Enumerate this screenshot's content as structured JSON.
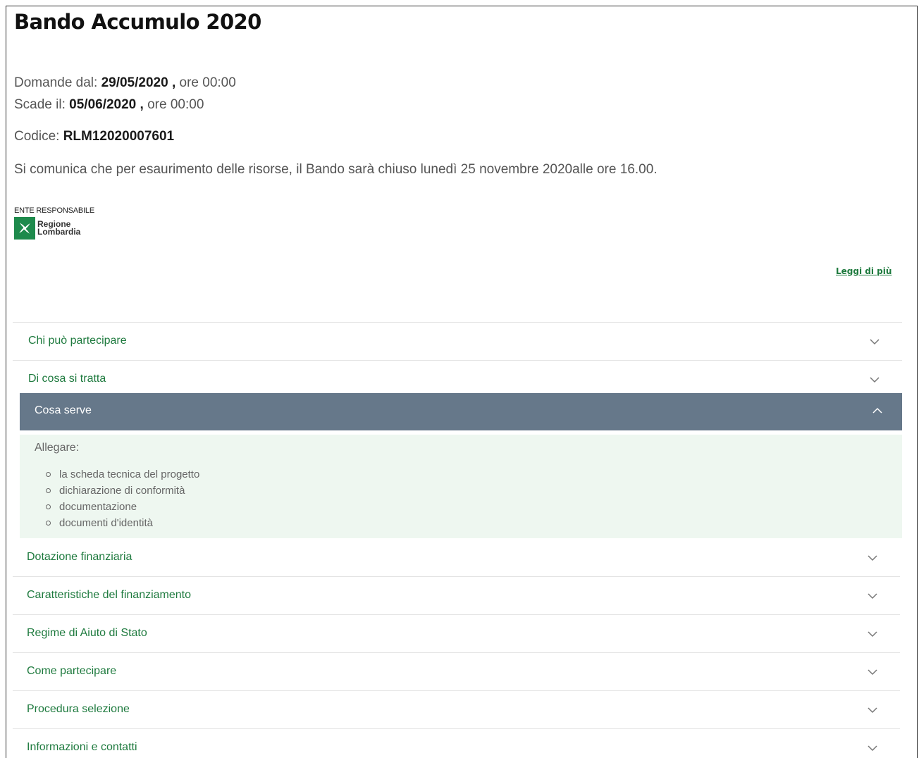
{
  "page": {
    "title": "Bando Accumulo 2020"
  },
  "dates": {
    "open_label": "Domande dal:",
    "open_date": "29/05/2020",
    "open_time": "ore 00:00",
    "close_label": "Scade il:",
    "close_date": "05/06/2020",
    "close_time": "ore 00:00",
    "separator": ","
  },
  "code": {
    "label": "Codice:",
    "value": "RLM12020007601"
  },
  "notice": "Si comunica che per esaurimento delle risorse, il Bando sarà chiuso lunedì 25 novembre 2020alle ore 16.00.",
  "responsible": {
    "label": "ENTE RESPONSABILE",
    "logo_line1": "Regione",
    "logo_line2": "Lombardia",
    "logo_color": "#1e8a4c"
  },
  "read_more": "Leggi di più",
  "accordion": {
    "before": [
      {
        "label": "Chi può partecipare",
        "icon": "chevron-down-icon"
      },
      {
        "label": "Di cosa si tratta",
        "icon": "chevron-down-icon"
      }
    ],
    "open": {
      "label": "Cosa serve",
      "icon": "chevron-up-icon",
      "intro": "Allegare:",
      "items": [
        "la scheda tecnica del progetto",
        "dichiarazione di conformità",
        "documentazione",
        "documenti d'identità"
      ]
    },
    "after": [
      {
        "label": "Dotazione finanziaria",
        "icon": "chevron-down-icon"
      },
      {
        "label": "Caratteristiche del finanziamento",
        "icon": "chevron-down-icon"
      },
      {
        "label": "Regime di Aiuto di Stato",
        "icon": "chevron-down-icon"
      },
      {
        "label": "Come partecipare",
        "icon": "chevron-down-icon"
      },
      {
        "label": "Procedura selezione",
        "icon": "chevron-down-icon"
      },
      {
        "label": "Informazioni e contatti",
        "icon": "chevron-down-icon"
      }
    ]
  },
  "colors": {
    "link_green": "#1e7a3e",
    "open_header": "#66788a",
    "panel_bg": "#eef7f0"
  }
}
